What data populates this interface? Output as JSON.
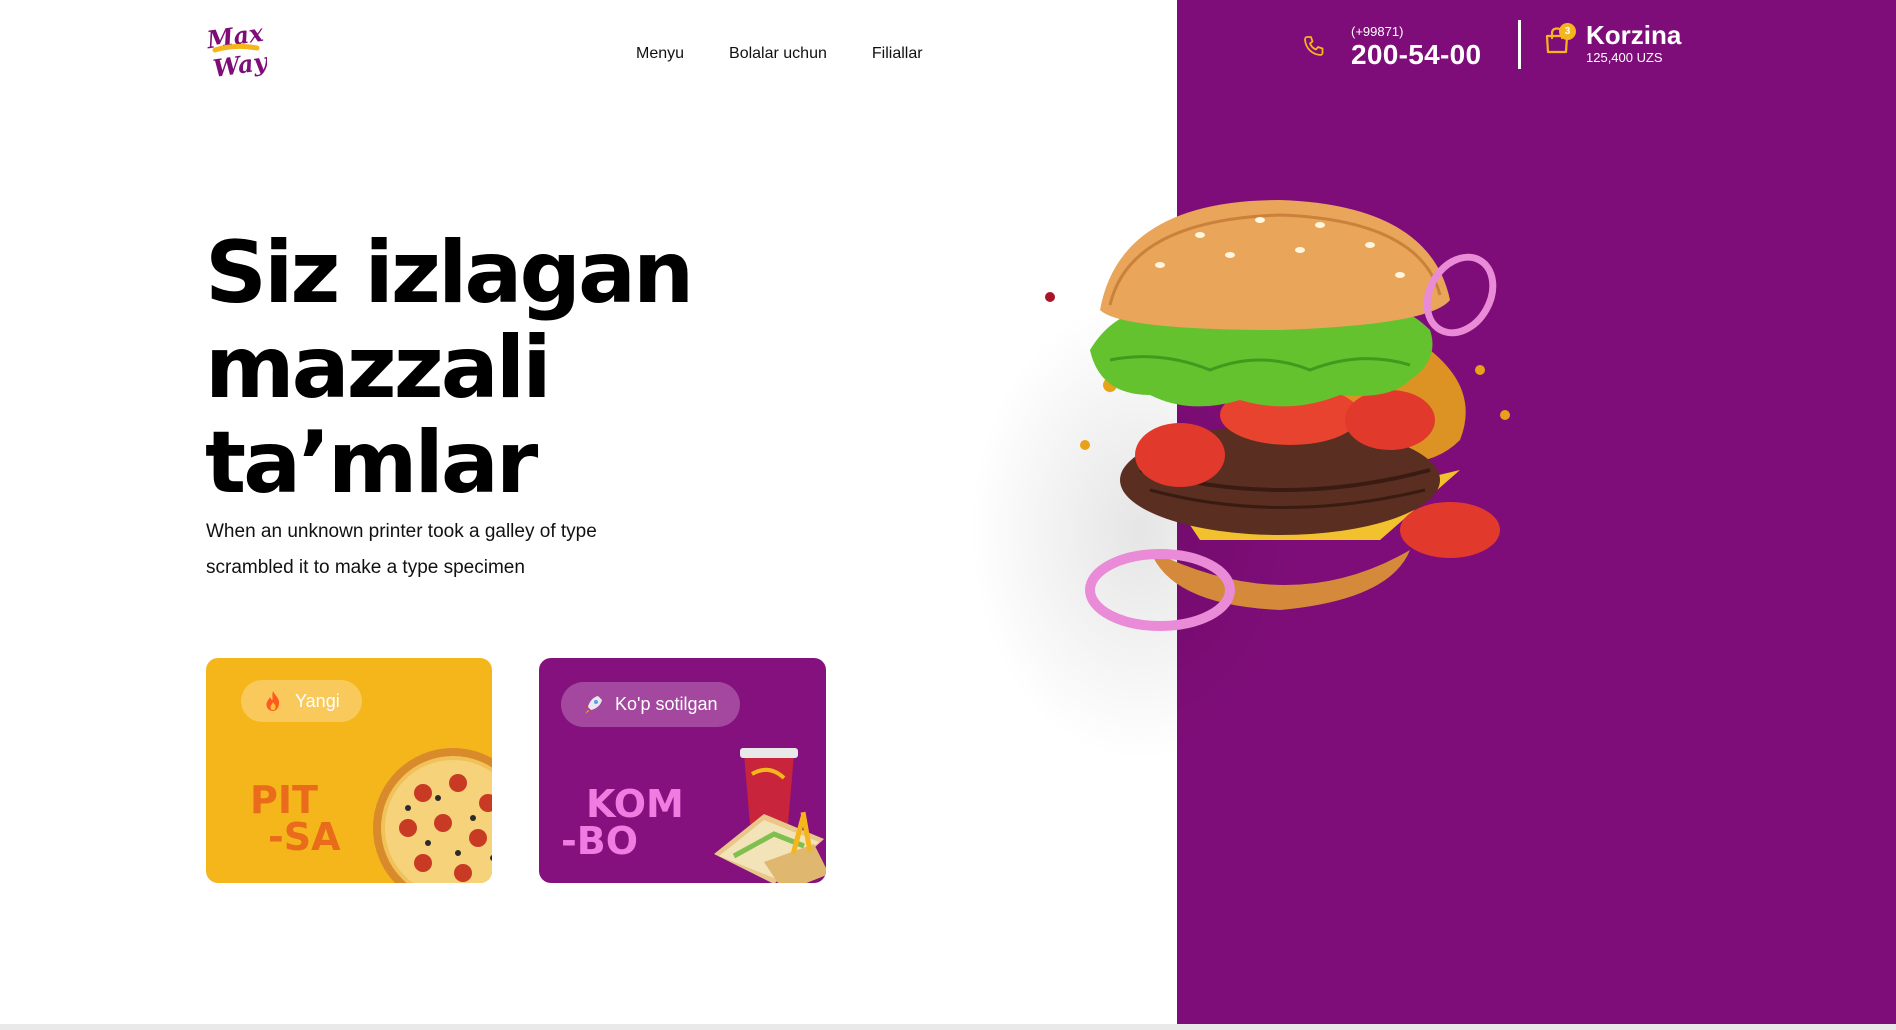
{
  "brand": {
    "logo_text_top": "Max",
    "logo_text_bottom": "Way"
  },
  "nav": {
    "items": [
      {
        "label": "Menyu"
      },
      {
        "label": "Bolalar uchun"
      },
      {
        "label": "Filiallar"
      }
    ]
  },
  "contact": {
    "prefix": "(+99871)",
    "number": "200-54-00"
  },
  "cart": {
    "title": "Korzina",
    "total": "125,400 UZS",
    "count": "3"
  },
  "hero": {
    "title_lines": [
      "Siz izlagan",
      "mazzali",
      "ta’mlar"
    ],
    "subtitle_lines": [
      "When an unknown printer took a galley of type",
      "scrambled it to make a type specimen"
    ]
  },
  "cards": [
    {
      "badge": "Yangi",
      "badge_icon": "fire-icon",
      "word_lines": [
        "PIT",
        "-SA"
      ]
    },
    {
      "badge": "Ko'p sotilgan",
      "badge_icon": "rocket-icon",
      "word_lines": [
        "KOM",
        "-BO"
      ]
    }
  ],
  "colors": {
    "brand_purple": "#7f0d79",
    "accent_yellow": "#f4b61b",
    "card_purple": "#85117f"
  }
}
